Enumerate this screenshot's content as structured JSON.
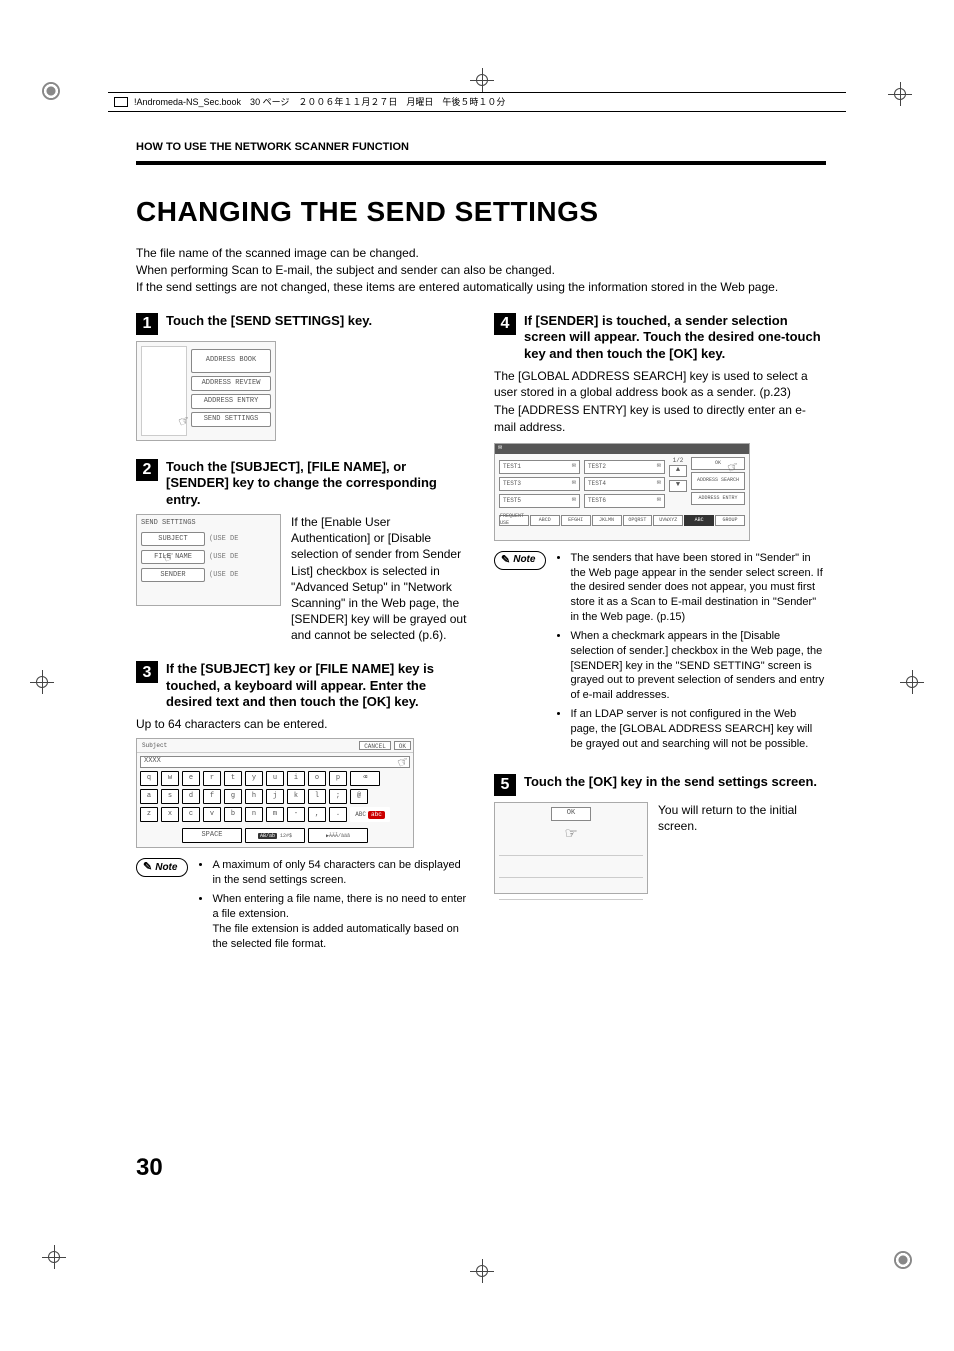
{
  "meta": {
    "strip_text": "!Andromeda-NS_Sec.book　30 ページ　２００６年１１月２７日　月曜日　午後５時１０分"
  },
  "running_head": "HOW TO USE THE NETWORK SCANNER FUNCTION",
  "title": "CHANGING THE SEND SETTINGS",
  "intro": {
    "l1": "The file name of the scanned image can be changed.",
    "l2": "When performing Scan to E-mail, the subject and sender can also be changed.",
    "l3": "If the send settings are not changed, these items are entered automatically using the information stored in the Web page."
  },
  "steps": {
    "s1": {
      "num": "1",
      "title": "Touch the [SEND SETTINGS] key.",
      "addr_buttons": [
        "ADDRESS BOOK",
        "ADDRESS REVIEW",
        "ADDRESS ENTRY",
        "SEND SETTINGS"
      ]
    },
    "s2": {
      "num": "2",
      "title": "Touch the [SUBJECT], [FILE NAME], or [SENDER] key to change the corresponding entry.",
      "ss_head": "SEND SETTINGS",
      "ss_rows": [
        {
          "label": "SUBJECT",
          "right": "(USE DE"
        },
        {
          "label": "FILE NAME",
          "right": "(USE DE"
        },
        {
          "label": "SENDER",
          "right": "(USE DE"
        }
      ],
      "side_text": "If the [Enable User Authentication] or [Disable selection of sender from Sender List] checkbox is selected in \"Advanced Setup\" in \"Network Scanning\" in the Web page, the [SENDER] key will be grayed out and cannot be selected (p.6)."
    },
    "s3": {
      "num": "3",
      "title": "If the [SUBJECT] key or [FILE NAME] key is touched, a keyboard will appear. Enter the desired text and then touch the [OK] key.",
      "sub": "Up to 64 characters can be entered.",
      "kb": {
        "top_left": "Subject",
        "cancel": "CANCEL",
        "ok": "OK",
        "input": "XXXX",
        "rows": [
          [
            "q",
            "w",
            "e",
            "r",
            "t",
            "y",
            "u",
            "i",
            "o",
            "p"
          ],
          [
            "a",
            "s",
            "d",
            "f",
            "g",
            "h",
            "j",
            "k",
            "l",
            ";",
            "@"
          ],
          [
            "z",
            "x",
            "c",
            "v",
            "b",
            "n",
            "m",
            "-",
            ",",
            "."
          ]
        ],
        "space": "SPACE",
        "mode1": "AB/ab",
        "mode1b": "12#$",
        "mode2": "ÀÄÂ/àäâ",
        "abc_label": "ABC",
        "abc_dark": "abc"
      },
      "note": {
        "label": "Note",
        "items": [
          "A maximum of only 54 characters can be displayed in the send settings screen.",
          "When entering a file name, there is no need to enter a file extension.\nThe file extension is added automatically based on the selected file format."
        ]
      }
    },
    "s4": {
      "num": "4",
      "title": "If [SENDER] is touched, a sender selection screen will appear. Touch the desired one-touch key and then touch the [OK] key.",
      "body1": "The [GLOBAL ADDRESS SEARCH] key is used to select a user stored in a global address book as a sender. (p.23)",
      "body2": "The [ADDRESS ENTRY] key is used to directly enter an e-mail address.",
      "sel": {
        "items": [
          "TEST1",
          "TEST2",
          "TEST3",
          "TEST4",
          "TEST5",
          "TEST6"
        ],
        "pager": "1/2",
        "ok": "OK",
        "side": [
          "ADDRESS SEARCH",
          "ADDRESS ENTRY"
        ],
        "tabs": [
          "FREQUENT USE",
          "ABCD",
          "EFGHI",
          "JKLMN",
          "OPQRST",
          "UVWXYZ",
          "ABC",
          "GROUP"
        ]
      },
      "note": {
        "label": "Note",
        "items": [
          "The senders that have been stored in \"Sender\" in the Web page appear in the sender select screen. If the desired sender does not appear, you must first store it as a Scan to E-mail destination in \"Sender\" in the Web page. (p.15)",
          "When a checkmark appears in the [Disable selection of sender.] checkbox in the Web page, the [SENDER] key in the \"SEND SETTING\" screen is grayed out to prevent selection of senders and entry of e-mail addresses.",
          "If an LDAP server is not configured in the Web page, the [GLOBAL ADDRESS SEARCH] key will be grayed out and searching will not be possible."
        ]
      }
    },
    "s5": {
      "num": "5",
      "title": "Touch the [OK] key in the send settings screen.",
      "side_text": "You will return to the initial screen.",
      "ok_label": "OK"
    }
  },
  "page_number": "30"
}
